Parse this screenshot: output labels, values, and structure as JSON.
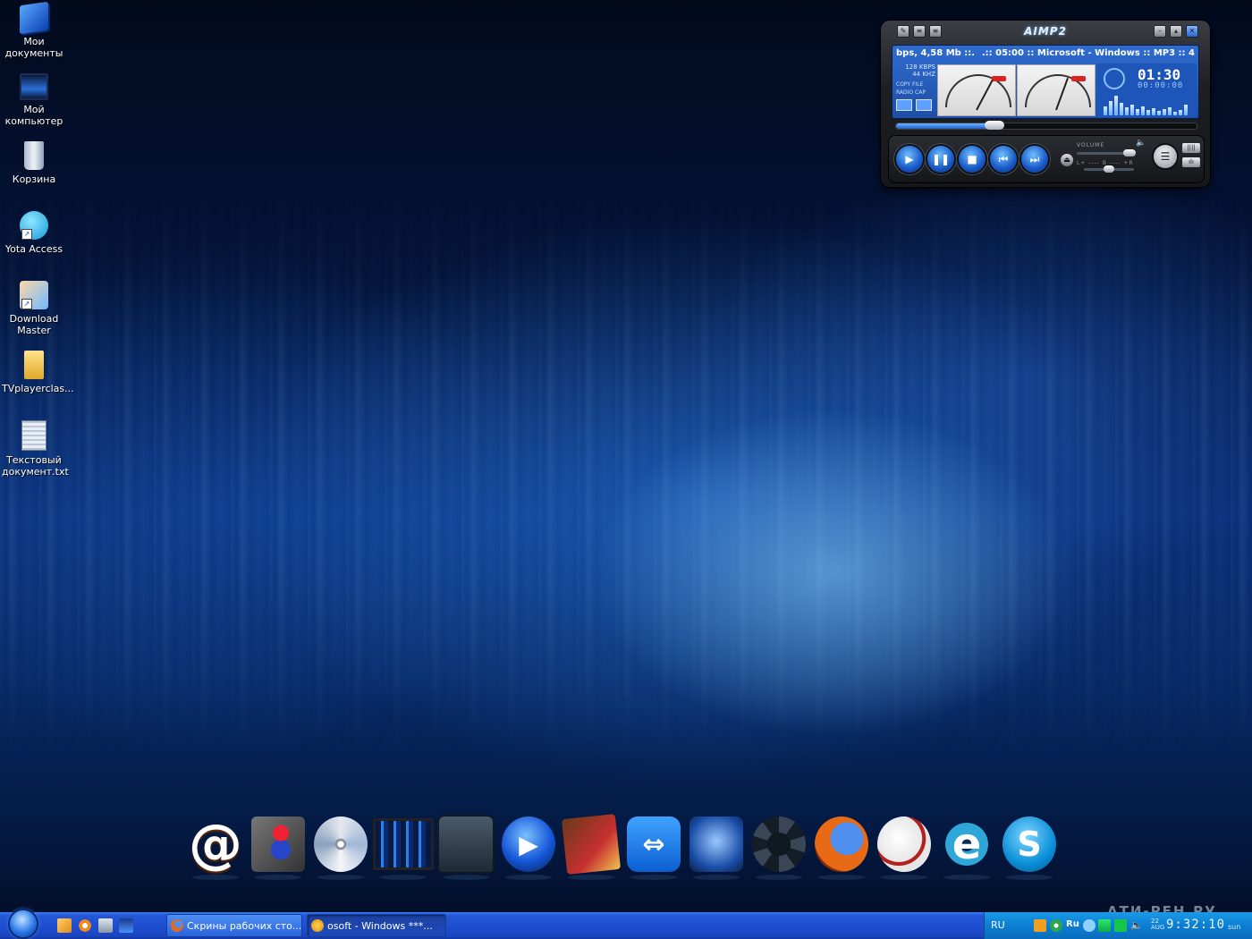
{
  "desktop": {
    "icons": [
      {
        "label": "Мои\nдокументы",
        "icon": "my-documents-icon"
      },
      {
        "label": "Мой\nкомпьютер",
        "icon": "my-computer-icon"
      },
      {
        "label": "Корзина",
        "icon": "recycle-bin-icon"
      },
      {
        "label": "Yota Access",
        "icon": "yota-access-icon"
      },
      {
        "label": "Download\nMaster",
        "icon": "download-master-icon"
      },
      {
        "label": "TVplayerclas...",
        "icon": "folder-icon"
      },
      {
        "label": "Текстовый\nдокумент.txt",
        "icon": "text-document-icon"
      }
    ]
  },
  "aimp": {
    "title": "AIMP2",
    "marquee_left": "bps, 4,58 Mb ::.",
    "marquee_right": ".:: 05:00 :: Microsoft - Windows :: MP3 :: 4",
    "bitrate": "128 KBPS",
    "samplerate": "44 KHZ",
    "flag1": "COPY FILE",
    "flag2": "RADIO CAP",
    "time_elapsed": "01:30",
    "time_secondary": "00:00:00",
    "volume_label": "VOLUME",
    "balance_label": "L+ ---- B ---- +R",
    "seek_progress": 0.31,
    "volume_level": 1.0
  },
  "dock": {
    "items": [
      {
        "name": "mail-agent",
        "icon": "at-sign-icon",
        "glyph": "@"
      },
      {
        "name": "mario-game",
        "icon": "mario-icon",
        "glyph": ""
      },
      {
        "name": "disc-burner",
        "icon": "burning-disc-icon",
        "glyph": ""
      },
      {
        "name": "my-computer",
        "icon": "monitor-icon",
        "glyph": ""
      },
      {
        "name": "briefcase",
        "icon": "briefcase-icon",
        "glyph": ""
      },
      {
        "name": "media-player",
        "icon": "play-orb-icon",
        "glyph": "▶"
      },
      {
        "name": "card-games",
        "icon": "cards-icon",
        "glyph": ""
      },
      {
        "name": "teamviewer",
        "icon": "teamviewer-icon",
        "glyph": "⇔"
      },
      {
        "name": "headset-app",
        "icon": "headset-icon",
        "glyph": ""
      },
      {
        "name": "settings",
        "icon": "gear-icon",
        "glyph": ""
      },
      {
        "name": "firefox",
        "icon": "firefox-icon",
        "glyph": ""
      },
      {
        "name": "opera",
        "icon": "opera-icon",
        "glyph": ""
      },
      {
        "name": "internet-explorer",
        "icon": "ie-icon",
        "glyph": "e"
      },
      {
        "name": "skype",
        "icon": "skype-icon",
        "glyph": "S"
      }
    ]
  },
  "watermark": "АТИ-РЕН.РУ",
  "taskbar": {
    "tasks": [
      {
        "label": "Скрины рабочих сто...",
        "icon": "firefox-icon",
        "active": false
      },
      {
        "label": "osoft - Windows ***...",
        "icon": "aimp-icon",
        "active": true
      }
    ],
    "language": "RU",
    "tray_text": "Ru",
    "date": "22\nAUG",
    "time": "9:32:10",
    "day": "sun"
  },
  "colors": {
    "taskbar": "#1e4fd0",
    "tray": "#0c7ed2",
    "aimp_screen": "#2f6ccf"
  }
}
